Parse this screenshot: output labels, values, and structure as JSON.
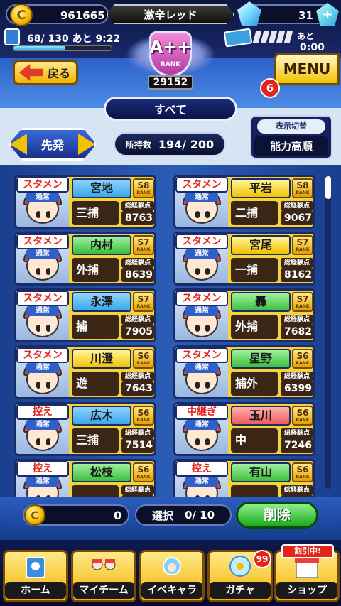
{
  "status": {
    "coins": "961665",
    "team_name": "激辛レッド",
    "gems": "31",
    "gem_add_symbol": "+",
    "stamina": "68/ 130 あと 9:22",
    "stamina_ratio": 0.52,
    "ticket_label": "あと",
    "ticket_time": "0:00"
  },
  "rank": {
    "grade": "A++",
    "word": "RANK",
    "score": "29152"
  },
  "header": {
    "back_label": "戻る",
    "menu_label": "MENU",
    "menu_badge": "6"
  },
  "filters": {
    "category": "すべて",
    "lineup": "先発",
    "owned_label": "所持数",
    "owned_count": "194/ 200",
    "sort_title": "表示切替",
    "sort_value": "能力高順"
  },
  "card_labels": {
    "exp_label": "総経験点",
    "rank_word": "RANK"
  },
  "cards": [
    {
      "role": "スタメン",
      "sub": "通常",
      "name": "宮地",
      "name_color": "blue",
      "rank": "S8",
      "position": "三捕",
      "exp": "8763"
    },
    {
      "role": "スタメン",
      "sub": "通常",
      "name": "平岩",
      "name_color": "yellow",
      "rank": "S8",
      "position": "二捕",
      "exp": "9067"
    },
    {
      "role": "スタメン",
      "sub": "通常",
      "name": "内村",
      "name_color": "green",
      "rank": "S7",
      "position": "外捕",
      "exp": "8639"
    },
    {
      "role": "スタメン",
      "sub": "通常",
      "name": "宮尾",
      "name_color": "yellow",
      "rank": "S7",
      "position": "一捕",
      "exp": "8162"
    },
    {
      "role": "スタメン",
      "sub": "通常",
      "name": "永澤",
      "name_color": "blue",
      "rank": "S7",
      "position": "捕",
      "exp": "7905"
    },
    {
      "role": "スタメン",
      "sub": "通常",
      "name": "轟",
      "name_color": "green",
      "rank": "S7",
      "position": "外捕",
      "exp": "7682"
    },
    {
      "role": "スタメン",
      "sub": "通常",
      "name": "川澄",
      "name_color": "yellow",
      "rank": "S6",
      "position": "遊",
      "exp": "7643"
    },
    {
      "role": "スタメン",
      "sub": "通常",
      "name": "星野",
      "name_color": "green",
      "rank": "S6",
      "position": "捕外",
      "exp": "6399"
    },
    {
      "role": "控え",
      "sub": "通常",
      "name": "広木",
      "name_color": "blue",
      "rank": "S6",
      "position": "三捕",
      "exp": "7514"
    },
    {
      "role": "中継ぎ",
      "sub": "通常",
      "name": "玉川",
      "name_color": "red",
      "rank": "S6",
      "position": "中",
      "exp": "7246"
    },
    {
      "role": "控え",
      "sub": "通常",
      "name": "松枝",
      "name_color": "green",
      "rank": "S6",
      "position": "",
      "exp": ""
    },
    {
      "role": "控え",
      "sub": "通常",
      "name": "有山",
      "name_color": "green",
      "rank": "S6",
      "position": "",
      "exp": ""
    }
  ],
  "action": {
    "coin_cost": "0",
    "select_label": "選択",
    "select_count": "0/ 10",
    "delete_label": "削除"
  },
  "nav": {
    "items": [
      "ホーム",
      "マイチーム",
      "イベキャラ",
      "ガチャ",
      "ショップ"
    ],
    "gacha_badge": "99",
    "sale_label": "割引中!"
  },
  "colors": {
    "card_bg": "#f3d23a",
    "accent_red": "#e2241a",
    "delete_green": "#1aa81a"
  }
}
